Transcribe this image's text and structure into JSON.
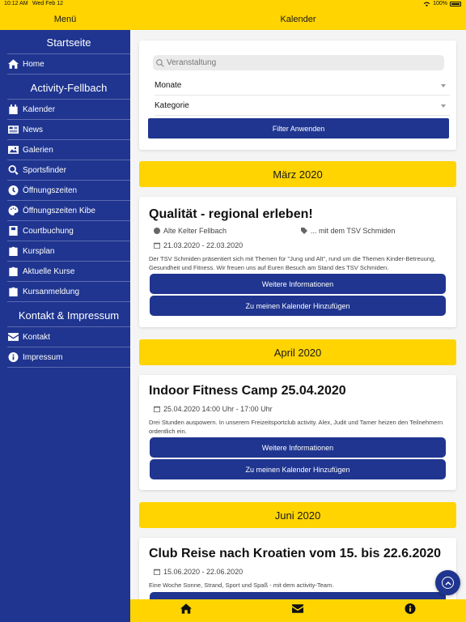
{
  "status": {
    "time": "10:12 AM",
    "date": "Wed Feb 12",
    "battery": "100%"
  },
  "sidebar": {
    "title": "Menü",
    "sections": [
      {
        "title": "Startseite",
        "items": [
          {
            "label": "Home",
            "icon": "home-icon"
          }
        ]
      },
      {
        "title": "Activity-Fellbach",
        "items": [
          {
            "label": "Kalender",
            "icon": "calendar-icon"
          },
          {
            "label": "News",
            "icon": "news-icon"
          },
          {
            "label": "Galerien",
            "icon": "gallery-icon"
          },
          {
            "label": "Sportsfinder",
            "icon": "search-icon"
          },
          {
            "label": "Öffnungszeiten",
            "icon": "clock-icon"
          },
          {
            "label": "Öffnungszeiten Kibe",
            "icon": "palette-icon"
          },
          {
            "label": "Courtbuchung",
            "icon": "book-icon"
          },
          {
            "label": "Kursplan",
            "icon": "clipboard-icon"
          },
          {
            "label": "Aktuelle Kurse",
            "icon": "clipboard-icon"
          },
          {
            "label": "Kursanmeldung",
            "icon": "clipboard-icon"
          }
        ]
      },
      {
        "title": "Kontakt & Impressum",
        "items": [
          {
            "label": "Kontakt",
            "icon": "envelope-icon"
          },
          {
            "label": "Impressum",
            "icon": "info-icon"
          }
        ]
      }
    ]
  },
  "main": {
    "title": "Kalender",
    "filter": {
      "search_placeholder": "Veranstaltung",
      "months_label": "Monate",
      "category_label": "Kategorie",
      "apply_label": "Filter Anwenden"
    },
    "months": [
      "März 2020",
      "April 2020",
      "Juni 2020"
    ],
    "events": [
      {
        "title": "Qualität - regional erleben!",
        "location": "Alte Kelter Fellbach",
        "tag": "... mit dem TSV Schmiden",
        "date": "21.03.2020 - 22.03.2020",
        "description": "Der TSV Schmiden präsentiert sich mit Themen für \"Jung und Alt\", rund um die Themen Kinder-Betreuung, Gesundheit und Fitness. Wir freuen uns auf Euren Besuch am Stand des TSV Schmiden.",
        "more_label": "Weitere Informationen",
        "calendar_label": "Zu meinen Kalender Hinzufügen"
      },
      {
        "title": "Indoor Fitness Camp 25.04.2020",
        "date": "25.04.2020 14:00 Uhr - 17:00 Uhr",
        "description": "Drei Stunden auspowern. In unserem Freizeitsportclub activity. Alex, Judit und Tamer heizen den Teilnehmern ordentlich ein.",
        "more_label": "Weitere Informationen",
        "calendar_label": "Zu meinen Kalender Hinzufügen"
      },
      {
        "title": "Club Reise nach Kroatien vom 15. bis 22.6.2020",
        "date": "15.06.2020 - 22.06.2020",
        "description": "Eine Woche Sonne, Strand, Sport und Spaß - mit dem activity-Team."
      }
    ]
  },
  "colors": {
    "brand_blue": "#1f3590",
    "brand_yellow": "#ffd400"
  },
  "bottom_nav": [
    "home-icon",
    "envelope-icon",
    "info-icon"
  ]
}
